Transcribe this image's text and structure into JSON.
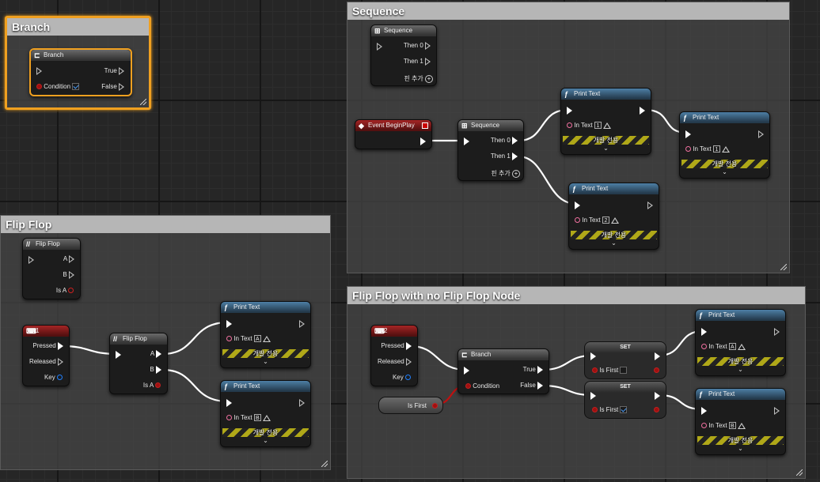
{
  "comments": {
    "branch": "Branch",
    "sequence": "Sequence",
    "flipflop": "Flip Flop",
    "flipflop_no_node": "Flip Flop with no Flip Flop Node"
  },
  "branch_node": {
    "title": "Branch",
    "condition": "Condition",
    "true_label": "True",
    "false_label": "False"
  },
  "seq_top": {
    "title": "Sequence",
    "then0": "Then 0",
    "then1": "Then 1",
    "add_pin": "핀 추가"
  },
  "event_begin": {
    "title": "Event BeginPlay"
  },
  "seq_main": {
    "title": "Sequence",
    "then0": "Then 0",
    "then1": "Then 1",
    "add_pin": "핀 추가"
  },
  "print_text": {
    "title": "Print Text",
    "in_text": "In Text",
    "dev_only": "개발 전용"
  },
  "print_values": {
    "p1": "1",
    "p2": "1",
    "p3": "2",
    "p4": "A",
    "p5": "B",
    "p6": "A",
    "p7": "B"
  },
  "flipflop_top": {
    "title": "Flip Flop",
    "a": "A",
    "b": "B",
    "is_a": "Is A"
  },
  "key_1": {
    "title": "1",
    "pressed": "Pressed",
    "released": "Released",
    "key": "Key"
  },
  "flipflop_main": {
    "title": "Flip Flop",
    "a": "A",
    "b": "B",
    "is_a": "Is A"
  },
  "key_2": {
    "title": "2",
    "pressed": "Pressed",
    "released": "Released",
    "key": "Key"
  },
  "branch2": {
    "title": "Branch",
    "condition": "Condition",
    "true_label": "True",
    "false_label": "False"
  },
  "is_first_var": {
    "label": "Is First"
  },
  "set1": {
    "title": "SET",
    "label": "Is First"
  },
  "set2": {
    "title": "SET",
    "label": "Is First"
  },
  "colors": {
    "selection": "#f0a020",
    "print_header": "#4d7fa5",
    "event_header": "#a52525",
    "exec_wire": "#ffffff",
    "bool_wire": "#c01010"
  }
}
